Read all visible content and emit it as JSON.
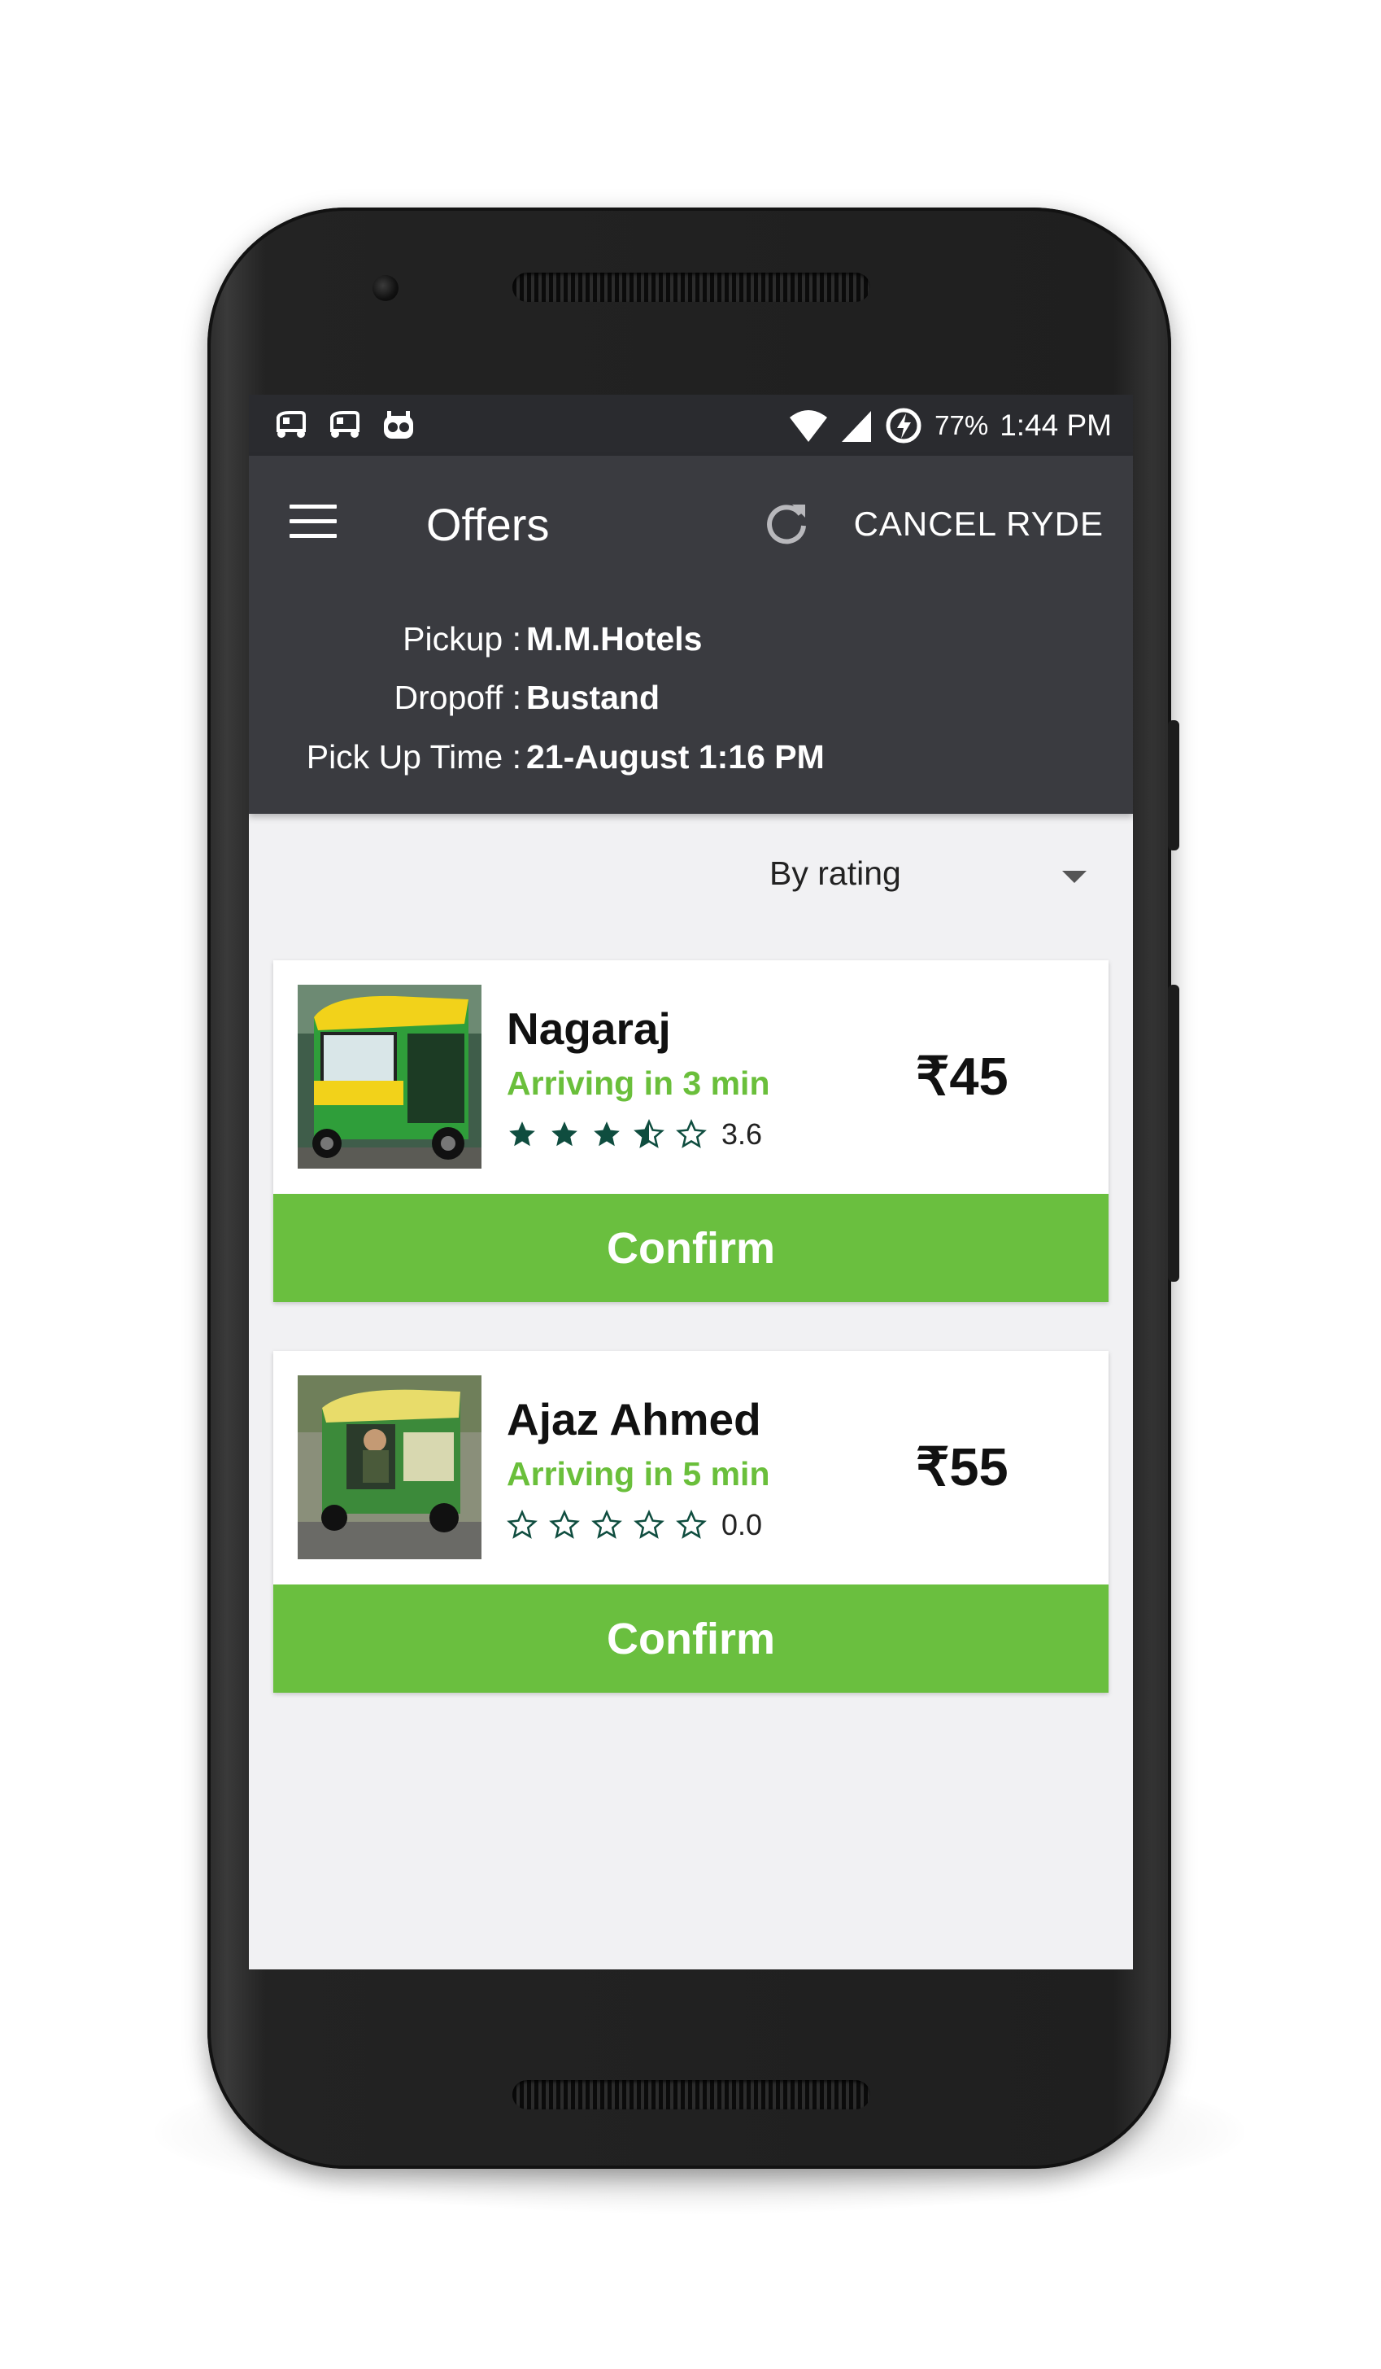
{
  "status_bar": {
    "left_icons": [
      "auto-rickshaw-icon",
      "auto-rickshaw-icon",
      "app-mascot-icon"
    ],
    "right_icons": [
      "wifi-icon",
      "cellular-signal-icon",
      "battery-charging-icon"
    ],
    "battery": "77%",
    "time": "1:44 PM"
  },
  "toolbar": {
    "menu_icon": "hamburger-menu-icon",
    "title": "Offers",
    "refresh_icon": "refresh-icon",
    "cancel_label": "CANCEL RYDE"
  },
  "trip": {
    "pickup_label": "Pickup :",
    "pickup_value": "M.M.Hotels",
    "dropoff_label": "Dropoff :",
    "dropoff_value": "Bustand",
    "time_label": "Pick Up Time :",
    "time_value": "21-August 1:16 PM"
  },
  "sort": {
    "selected": "By rating"
  },
  "offers": [
    {
      "driver": "Nagaraj",
      "eta": "Arriving in 3 min",
      "rating": 3.6,
      "rating_text": "3.6",
      "price": "₹45",
      "confirm_label": "Confirm"
    },
    {
      "driver": "Ajaz Ahmed",
      "eta": "Arriving in 5 min",
      "rating": 0.0,
      "rating_text": "0.0",
      "price": "₹55",
      "confirm_label": "Confirm"
    }
  ],
  "colors": {
    "toolbar": "#3a3b40",
    "status_bar": "#2a2b2f",
    "accent_green": "#6abf3f",
    "star": "#0f4d3f"
  }
}
